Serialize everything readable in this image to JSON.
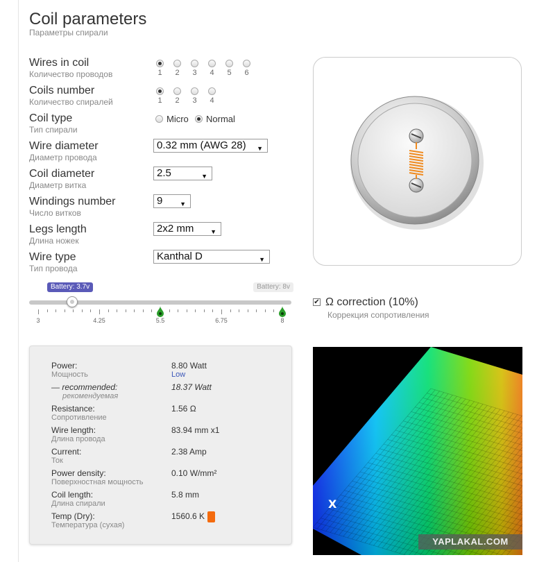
{
  "header": {
    "title": "Coil parameters",
    "subtitle": "Параметры спирали"
  },
  "params": [
    {
      "label": "Wires in coil",
      "sub": "Количество проводов",
      "type": "radio",
      "options": [
        "1",
        "2",
        "3",
        "4",
        "5",
        "6"
      ],
      "selected": "1"
    },
    {
      "label": "Coils number",
      "sub": "Количество спиралей",
      "type": "radio",
      "options": [
        "1",
        "2",
        "3",
        "4"
      ],
      "selected": "1"
    },
    {
      "label": "Coil type",
      "sub": "Тип спирали",
      "type": "radio-inline",
      "options": [
        "Micro",
        "Normal"
      ],
      "selected": "Normal"
    },
    {
      "label": "Wire diameter",
      "sub": "Диаметр провода",
      "type": "select",
      "value": "0.32 mm (AWG 28)"
    },
    {
      "label": "Coil diameter",
      "sub": "Диаметр витка",
      "type": "select",
      "value": "2.5"
    },
    {
      "label": "Windings number",
      "sub": "Число витков",
      "type": "select",
      "value": "9"
    },
    {
      "label": "Legs length",
      "sub": "Длина ножек",
      "type": "select",
      "value": "2x2 mm"
    },
    {
      "label": "Wire type",
      "sub": "Тип провода",
      "type": "select",
      "value": "Kanthal D"
    }
  ],
  "slider": {
    "low_badge": "Battery: 3.7v",
    "high_badge": "Battery: 8v",
    "min": 3,
    "max": 8,
    "value": 3.7,
    "tick_labels": [
      "3",
      "4.25",
      "5.5",
      "6.75",
      "8"
    ],
    "recommended_markers": [
      5.5,
      8
    ]
  },
  "correction": {
    "checked": true,
    "label": "Ω correction (10%)",
    "sub": "Коррекция сопротивления"
  },
  "results": {
    "power": {
      "label": "Power:",
      "sub": "Мощность",
      "value": "8.80 Watt",
      "note": "Low"
    },
    "recommended": {
      "label": "— recommended:",
      "sub": "рекомендуемая",
      "value": "18.37 Watt"
    },
    "resistance": {
      "label": "Resistance:",
      "sub": "Сопротивление",
      "value": "1.56 Ω"
    },
    "wire_length": {
      "label": "Wire length:",
      "sub": "Длина провода",
      "value": "83.94 mm x1"
    },
    "current": {
      "label": "Current:",
      "sub": "Ток",
      "value": "2.38 Amp"
    },
    "power_density": {
      "label": "Power density:",
      "sub": "Поверхностная мощность",
      "value": "0.10 W/mm²"
    },
    "coil_length": {
      "label": "Coil length:",
      "sub": "Длина спирали",
      "value": "5.8 mm"
    },
    "temp": {
      "label": "Temp (Dry):",
      "sub": "Температура (сухая)",
      "value": "1560.6 K"
    }
  },
  "heatmap": {
    "axis_label": "X"
  },
  "watermark": "YAPLAKAL.COM",
  "colors": {
    "badge": "#5a5ab8",
    "low_link": "#3a56b8",
    "temp_swatch": "#f46b0e",
    "coil": "#f08a1e",
    "marker": "#2a9d2a"
  }
}
